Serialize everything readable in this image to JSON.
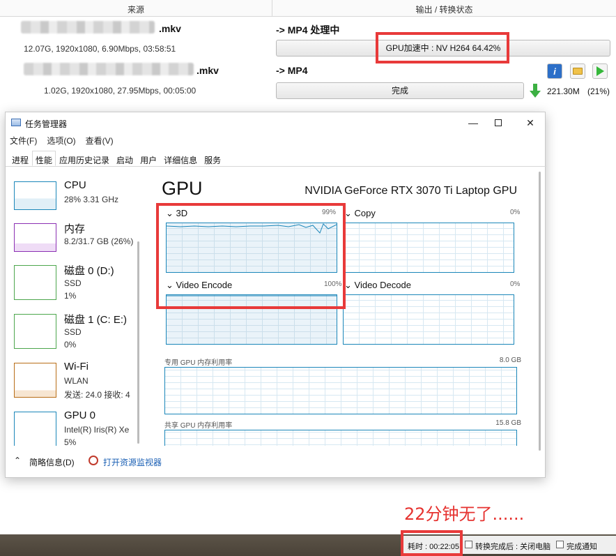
{
  "converter": {
    "header": {
      "source": "来源",
      "output": "输出 / 转换状态"
    },
    "rows": [
      {
        "ext": ".mkv",
        "meta": "12.07G, 1920x1080, 6.90Mbps, 03:58:51",
        "target": "-> MP4 处理中",
        "progress_text": "GPU加速中 : NV H264 64.42%",
        "progress": 0.6442
      },
      {
        "ext": ".mkv",
        "meta": "1.02G, 1920x1080, 27.95Mbps, 00:05:00",
        "target": "-> MP4",
        "progress_text": "完成",
        "progress": 1.0,
        "out_size": "221.30M",
        "ratio": "(21%)"
      }
    ]
  },
  "taskmgr": {
    "title": "任务管理器",
    "menu": [
      "文件(F)",
      "选项(O)",
      "查看(V)"
    ],
    "tabs": [
      "进程",
      "性能",
      "应用历史记录",
      "启动",
      "用户",
      "详细信息",
      "服务"
    ],
    "active_tab": "性能",
    "sidebar": [
      {
        "name": "CPU",
        "l2": "28% 3.31 GHz",
        "l3": "",
        "color": "#1a86b9"
      },
      {
        "name": "内存",
        "l2": "8.2/31.7 GB (26%)",
        "l3": "",
        "color": "#8b2fb3"
      },
      {
        "name": "磁盘 0 (D:)",
        "l2": "SSD",
        "l3": "1%",
        "color": "#4ca64c"
      },
      {
        "name": "磁盘 1 (C: E:)",
        "l2": "SSD",
        "l3": "0%",
        "color": "#4ca64c"
      },
      {
        "name": "Wi-Fi",
        "l2": "WLAN",
        "l3": "发送: 24.0  接收: 4",
        "color": "#b86d16"
      },
      {
        "name": "GPU 0",
        "l2": "Intel(R) Iris(R) Xe",
        "l3": "5%",
        "color": "#1a86b9"
      }
    ],
    "gpu": {
      "title": "GPU",
      "model": "NVIDIA GeForce RTX 3070 Ti Laptop GPU",
      "engines": [
        {
          "label": "3D",
          "pct": "99%"
        },
        {
          "label": "Copy",
          "pct": "0%"
        },
        {
          "label": "Video Encode",
          "pct": "100%"
        },
        {
          "label": "Video Decode",
          "pct": "0%"
        }
      ],
      "dedicated_label": "专用 GPU 内存利用率",
      "dedicated_max": "8.0 GB",
      "shared_label": "共享 GPU 内存利用率",
      "shared_max": "15.8 GB"
    },
    "footer": {
      "brief": "简略信息(D)",
      "monitor": "打开资源监视器"
    }
  },
  "statusbar": {
    "elapsed": "耗时 : 00:22:05",
    "after_done": "转换完成后 : 关闭电脑",
    "notify": "完成通知"
  },
  "annotation": "22分钟无了......"
}
